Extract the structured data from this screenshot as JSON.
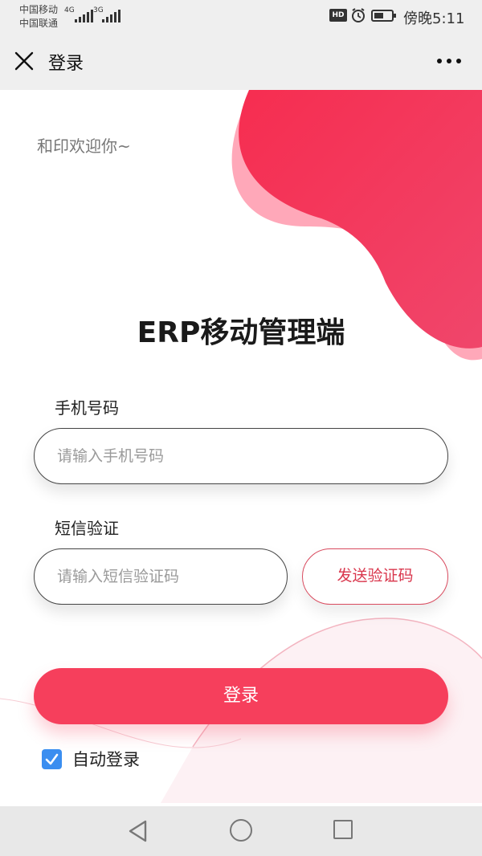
{
  "status_bar": {
    "carrier_1": "中国移动",
    "carrier_2": "中国联通",
    "network_1": "4G",
    "network_2": "3G",
    "hd_badge": "HD",
    "time": "傍晚5:11"
  },
  "title_bar": {
    "title": "登录",
    "close_icon": "close-icon",
    "more_icon": "more-icon"
  },
  "welcome_text": "和印欢迎你~",
  "app_title": "ERP移动管理端",
  "form": {
    "phone_label": "手机号码",
    "phone_placeholder": "请输入手机号码",
    "phone_value": "",
    "sms_label": "短信验证",
    "sms_placeholder": "请输入短信验证码",
    "sms_value": "",
    "send_code_label": "发送验证码",
    "login_label": "登录",
    "auto_login_label": "自动登录",
    "auto_login_checked": true
  },
  "colors": {
    "accent": "#f63f5c",
    "accent_light": "#ff9fb1",
    "checkbox": "#3b8ef0"
  },
  "nav_bar": {
    "icons": [
      "back-triangle-icon",
      "home-circle-icon",
      "recent-square-icon"
    ]
  }
}
